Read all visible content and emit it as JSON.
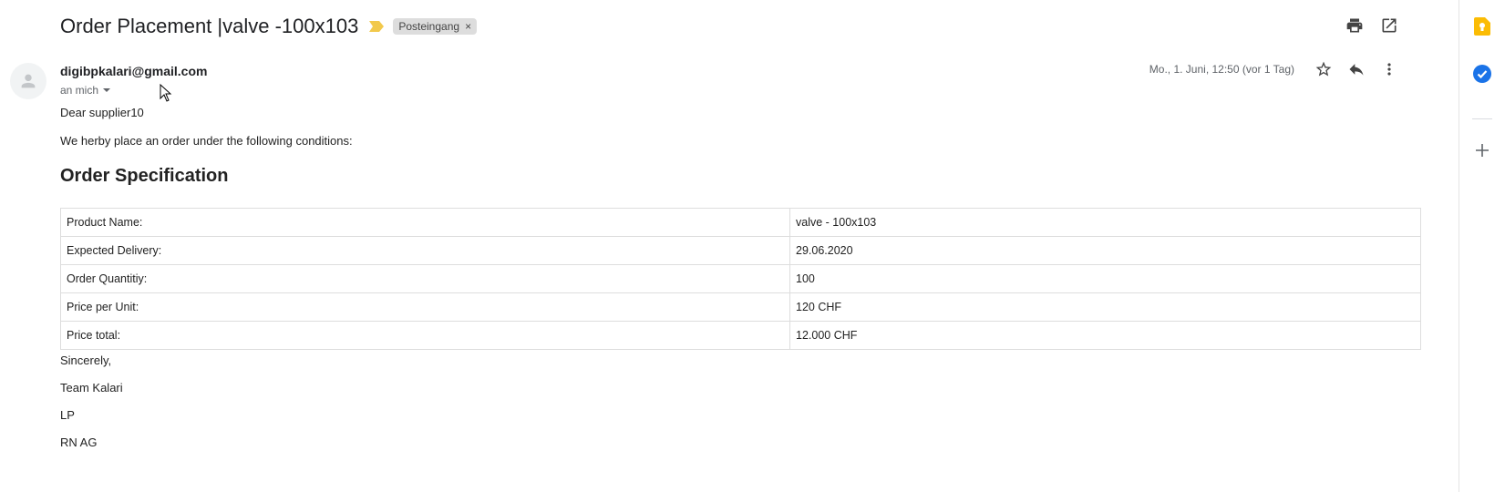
{
  "email": {
    "subject": "Order Placement |valve -100x103",
    "label": "Posteingang",
    "label_remove": "×",
    "sender": "digibpkalari@gmail.com",
    "recipient": "an mich",
    "date": "Mo., 1. Juni, 12:50 (vor 1 Tag)",
    "greeting": "Dear supplier10",
    "intro": "We herby place an order under the following conditions:",
    "heading": "Order Specification",
    "table": [
      {
        "label": "Product Name:",
        "value": "valve - 100x103"
      },
      {
        "label": "Expected Delivery:",
        "value": "29.06.2020"
      },
      {
        "label": "Order Quantitiy:",
        "value": "100"
      },
      {
        "label": "Price per Unit:",
        "value": "120 CHF"
      },
      {
        "label": "Price total:",
        "value": "12.000 CHF"
      }
    ],
    "closing": [
      "Sincerely,",
      "Team Kalari",
      "LP",
      "RN AG"
    ]
  },
  "icons": {
    "top": [
      "print-icon",
      "open-in-new-window-icon"
    ],
    "meta": [
      "star-icon",
      "reply-icon",
      "more-vert-icon"
    ],
    "sidebar": [
      "keep-icon",
      "tasks-icon",
      "add-icon"
    ]
  },
  "colors": {
    "importance": "#f2c94c",
    "keep": "#fbbc04",
    "tasks": "#1a73e8"
  }
}
